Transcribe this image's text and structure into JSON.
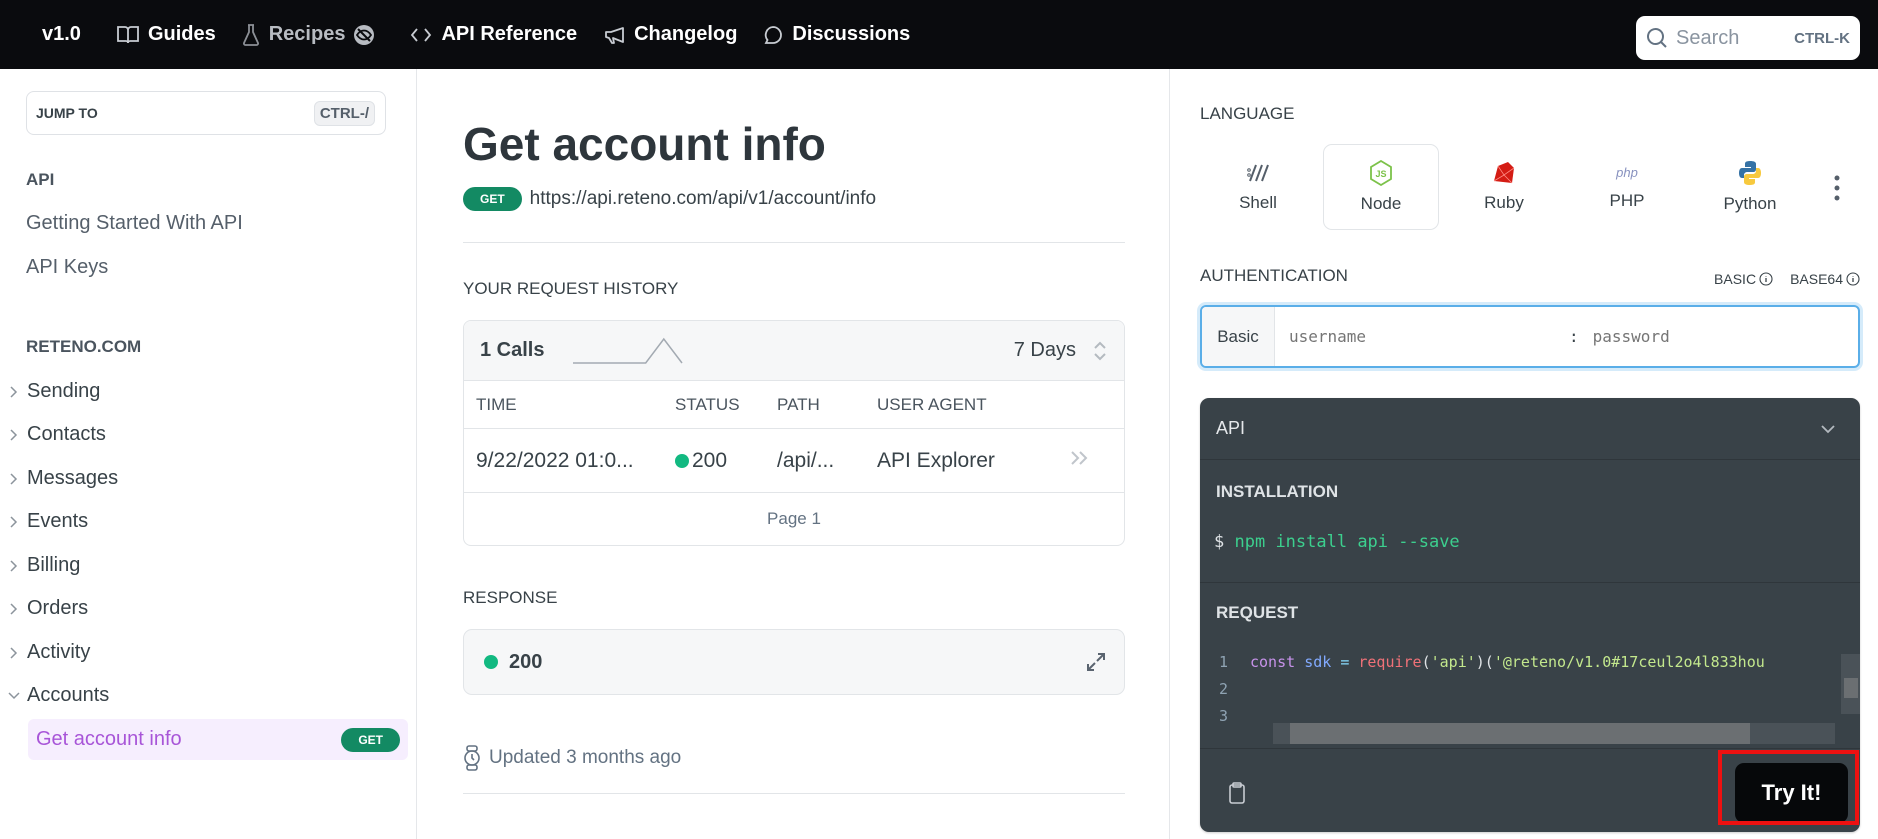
{
  "topbar": {
    "version": "v1.0",
    "nav": [
      {
        "label": "Guides",
        "icon": "book-icon"
      },
      {
        "label": "Recipes",
        "icon": "flask-icon",
        "badge_icon": "hidden-icon"
      },
      {
        "label": "API Reference",
        "icon": "code-icon"
      },
      {
        "label": "Changelog",
        "icon": "megaphone-icon"
      },
      {
        "label": "Discussions",
        "icon": "chat-bubble-icon"
      }
    ],
    "search": {
      "placeholder": "Search",
      "shortcut": "CTRL-K"
    }
  },
  "sidebar": {
    "jump_to": {
      "label": "JUMP TO",
      "shortcut": "CTRL-/"
    },
    "sections": [
      {
        "heading": "API",
        "links": [
          "Getting Started With API",
          "API Keys"
        ]
      },
      {
        "heading": "RETENO.COM",
        "categories": [
          {
            "label": "Sending",
            "expanded": false
          },
          {
            "label": "Contacts",
            "expanded": false
          },
          {
            "label": "Messages",
            "expanded": false
          },
          {
            "label": "Events",
            "expanded": false
          },
          {
            "label": "Billing",
            "expanded": false
          },
          {
            "label": "Orders",
            "expanded": false
          },
          {
            "label": "Activity",
            "expanded": false
          },
          {
            "label": "Accounts",
            "expanded": true
          }
        ]
      }
    ],
    "active_item": {
      "label": "Get account info",
      "method": "GET"
    }
  },
  "main": {
    "title": "Get account info",
    "method": "GET",
    "url": "https://api.reteno.com/api/v1/account/info",
    "history": {
      "heading": "YOUR REQUEST HISTORY",
      "calls": "1 Calls",
      "sparkline": [
        0,
        0,
        0,
        0,
        0,
        1,
        0
      ],
      "range": "7 Days",
      "columns": [
        "TIME",
        "STATUS",
        "PATH",
        "USER AGENT"
      ],
      "rows": [
        {
          "time": "9/22/2022 01:0...",
          "status": "200",
          "path": "/api/...",
          "user_agent": "API Explorer"
        }
      ],
      "pager": "Page 1"
    },
    "response": {
      "heading": "RESPONSE",
      "status": "200"
    },
    "updated": "Updated 3 months ago"
  },
  "right": {
    "language_label": "LANGUAGE",
    "languages": [
      {
        "name": "Shell",
        "active": false
      },
      {
        "name": "Node",
        "active": true
      },
      {
        "name": "Ruby",
        "active": false
      },
      {
        "name": "PHP",
        "active": false
      },
      {
        "name": "Python",
        "active": false
      }
    ],
    "auth": {
      "label": "AUTHENTICATION",
      "options": [
        "BASIC",
        "BASE64"
      ],
      "scheme": "Basic",
      "username_placeholder": "username",
      "separator": ":",
      "password_placeholder": "password"
    },
    "code": {
      "header": "API",
      "installation_label": "INSTALLATION",
      "install_prompt": "$",
      "install_cmd": "npm install api --save",
      "request_label": "REQUEST",
      "line_numbers": [
        "1",
        "2",
        "3"
      ],
      "line1": {
        "kw": "const",
        "var": "sdk",
        "op": "=",
        "fn": "require",
        "p1": "(",
        "s1": "'api'",
        "p2": ")(",
        "s2": "'@reteno/v1.0#17ceul2o4l833hou"
      },
      "try_label": "Try It!"
    }
  }
}
